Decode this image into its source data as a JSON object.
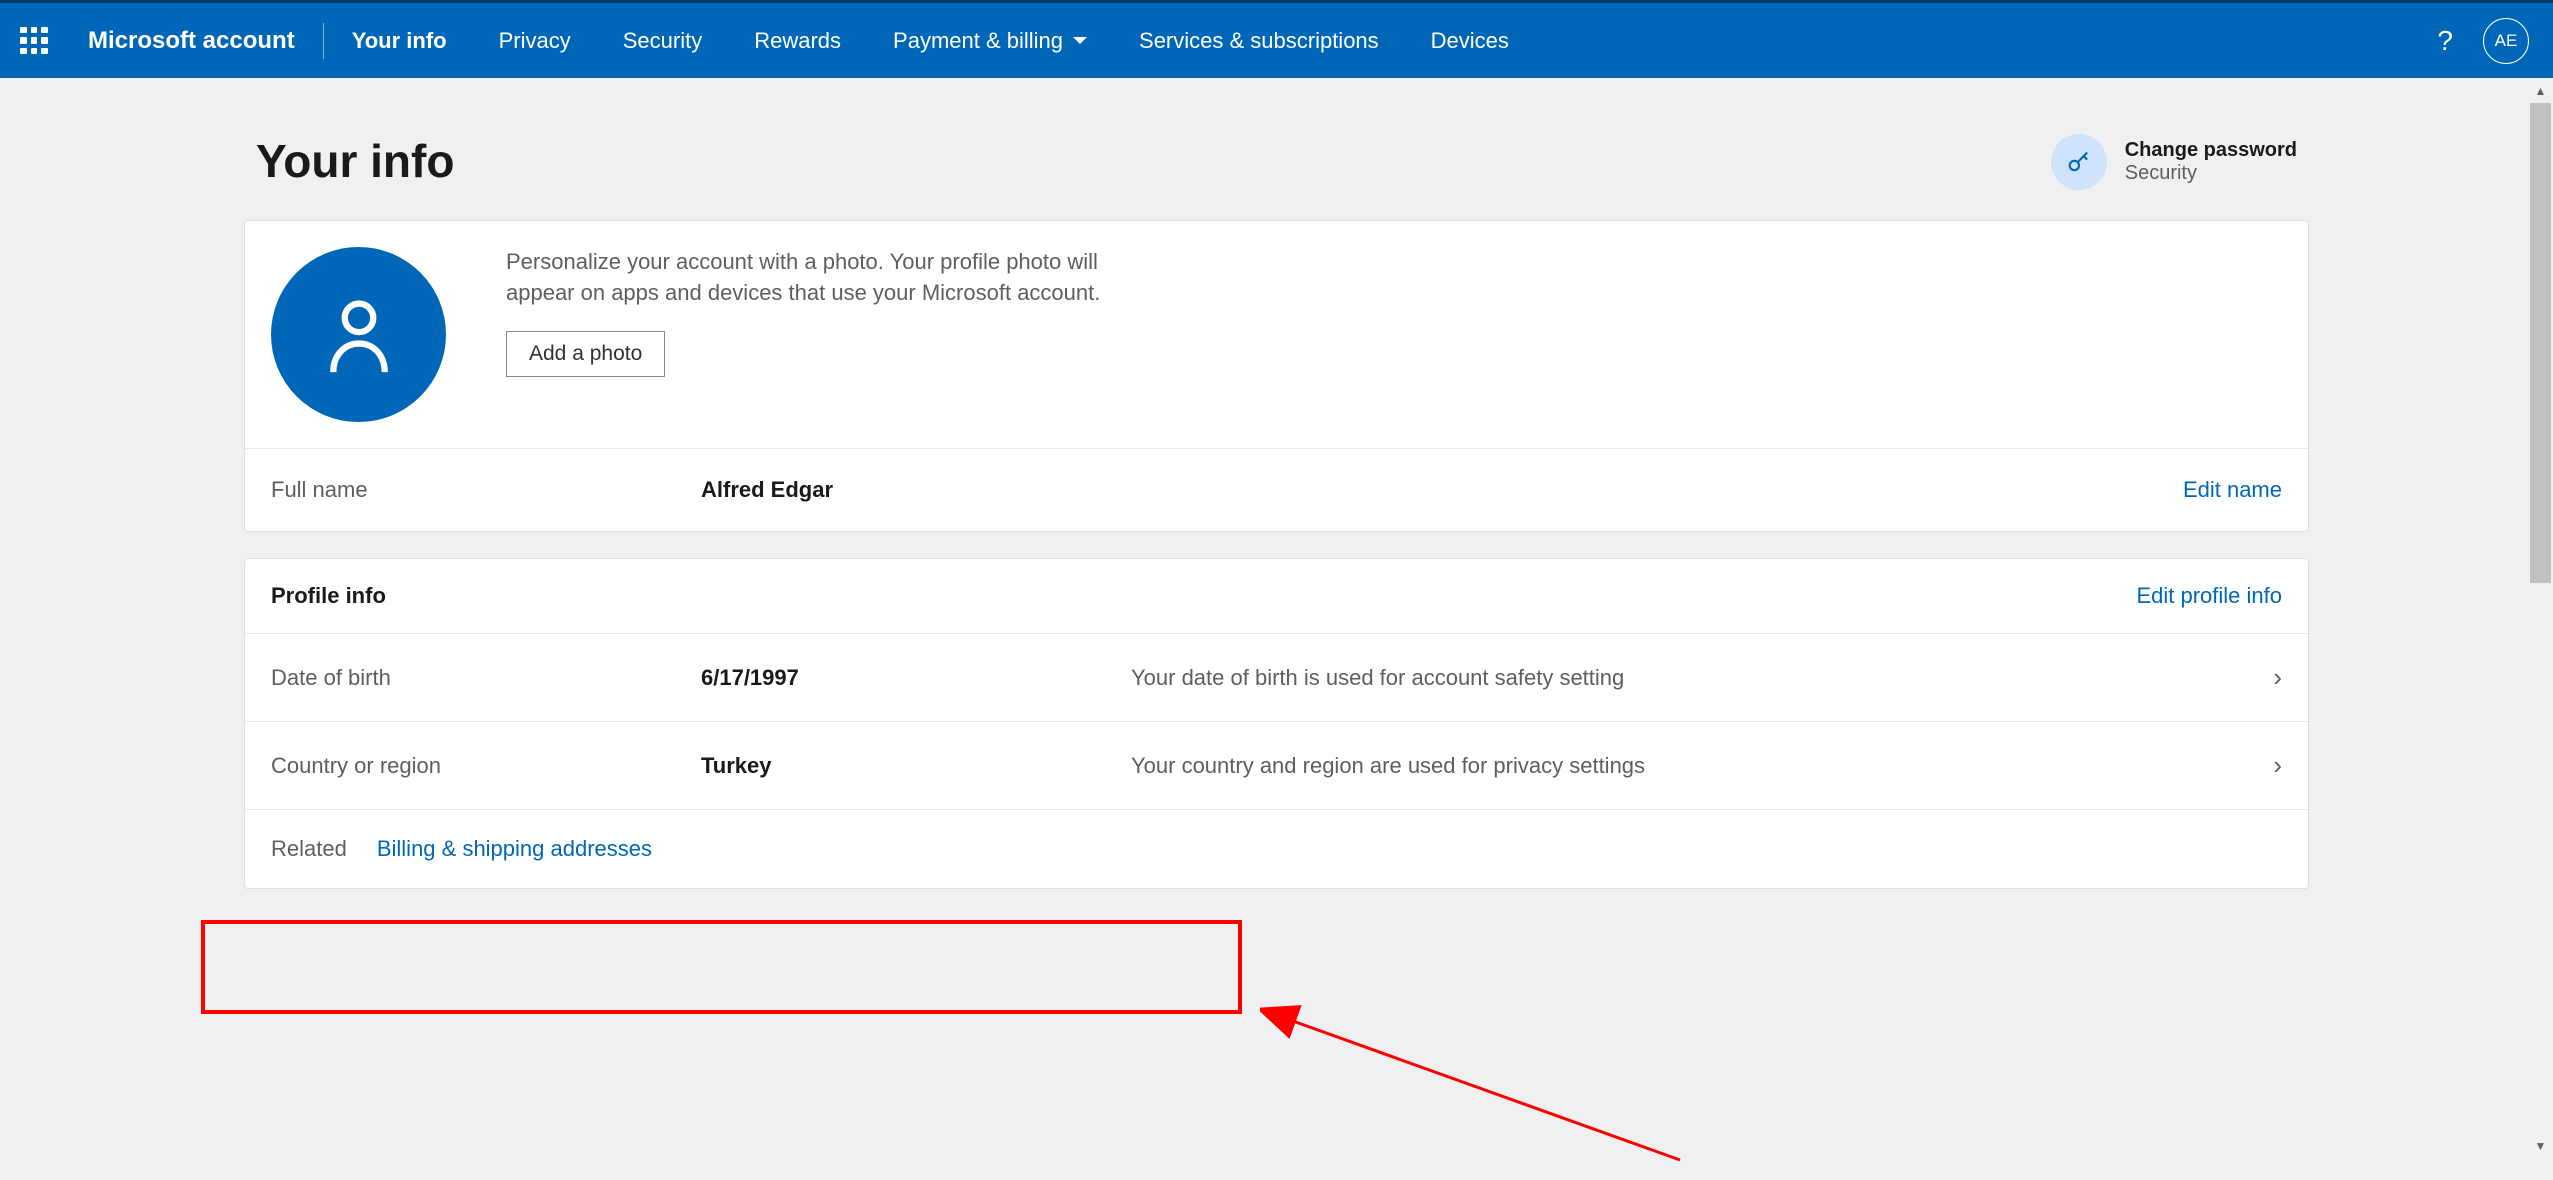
{
  "header": {
    "brand": "Microsoft account",
    "nav": {
      "your_info": "Your info",
      "privacy": "Privacy",
      "security": "Security",
      "rewards": "Rewards",
      "payment_billing": "Payment & billing",
      "services": "Services & subscriptions",
      "devices": "Devices"
    },
    "avatar_initials": "AE",
    "help_glyph": "?"
  },
  "page": {
    "title": "Your info",
    "change_password": {
      "title": "Change password",
      "subtitle": "Security"
    }
  },
  "profile_card": {
    "photo_description": "Personalize your account with a photo. Your profile photo will appear on apps and devices that use your Microsoft account.",
    "add_photo_label": "Add a photo",
    "full_name": {
      "label": "Full name",
      "value": "Alfred Edgar",
      "edit_label": "Edit name"
    }
  },
  "profile_info": {
    "section_title": "Profile info",
    "edit_label": "Edit profile info",
    "dob": {
      "label": "Date of birth",
      "value": "6/17/1997",
      "desc": "Your date of birth is used for account safety setting"
    },
    "country": {
      "label": "Country or region",
      "value": "Turkey",
      "desc": "Your country and region are used for privacy settings"
    },
    "related": {
      "label": "Related",
      "link": "Billing & shipping addresses"
    }
  }
}
